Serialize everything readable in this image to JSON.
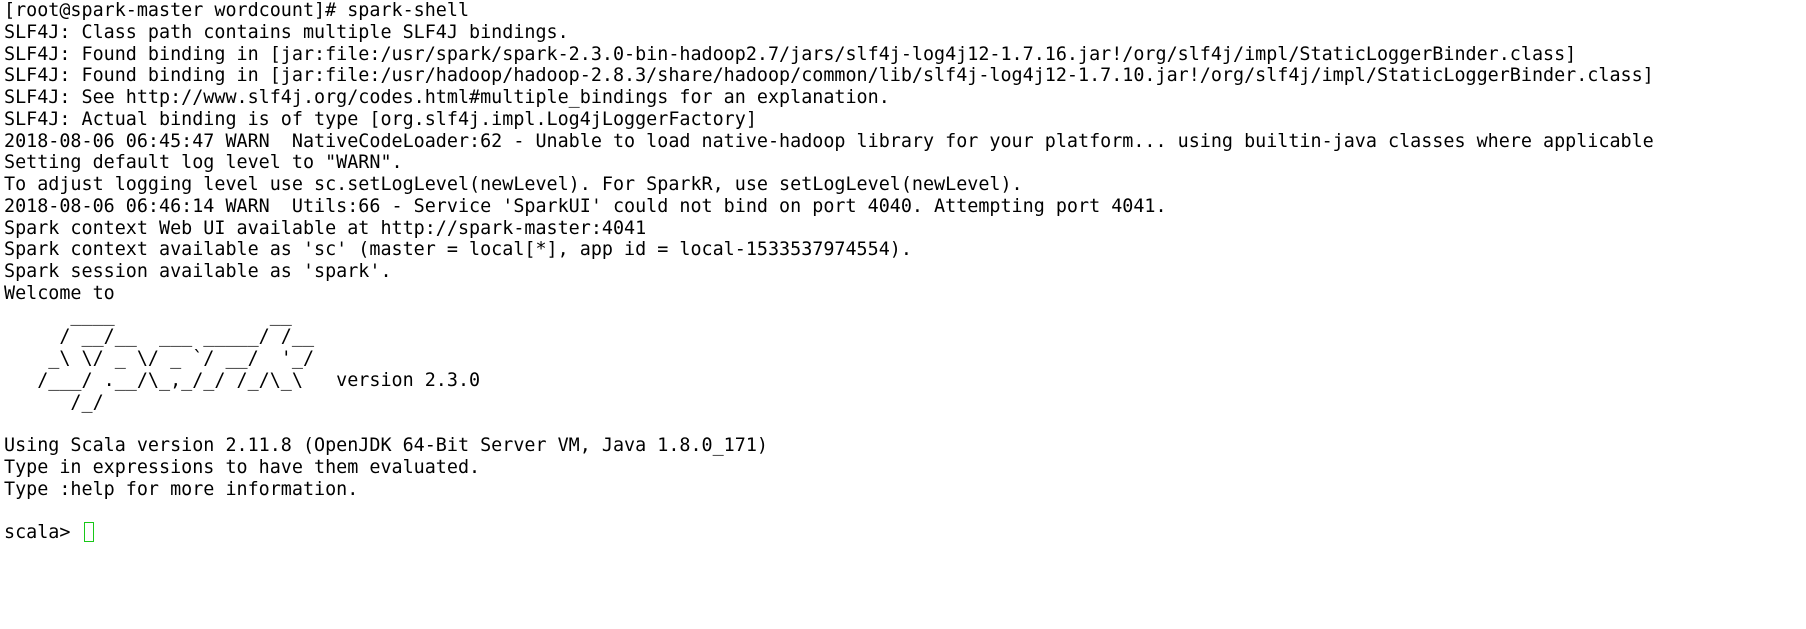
{
  "terminal": {
    "lines": [
      "[root@spark-master wordcount]# spark-shell",
      "SLF4J: Class path contains multiple SLF4J bindings.",
      "SLF4J: Found binding in [jar:file:/usr/spark/spark-2.3.0-bin-hadoop2.7/jars/slf4j-log4j12-1.7.16.jar!/org/slf4j/impl/StaticLoggerBinder.class]",
      "SLF4J: Found binding in [jar:file:/usr/hadoop/hadoop-2.8.3/share/hadoop/common/lib/slf4j-log4j12-1.7.10.jar!/org/slf4j/impl/StaticLoggerBinder.class]",
      "SLF4J: See http://www.slf4j.org/codes.html#multiple_bindings for an explanation.",
      "SLF4J: Actual binding is of type [org.slf4j.impl.Log4jLoggerFactory]",
      "2018-08-06 06:45:47 WARN  NativeCodeLoader:62 - Unable to load native-hadoop library for your platform... using builtin-java classes where applicable",
      "Setting default log level to \"WARN\".",
      "To adjust logging level use sc.setLogLevel(newLevel). For SparkR, use setLogLevel(newLevel).",
      "2018-08-06 06:46:14 WARN  Utils:66 - Service 'SparkUI' could not bind on port 4040. Attempting port 4041.",
      "Spark context Web UI available at http://spark-master:4041",
      "Spark context available as 'sc' (master = local[*], app id = local-1533537974554).",
      "Spark session available as 'spark'.",
      "Welcome to",
      "      ____              __",
      "     / __/__  ___ _____/ /__",
      "    _\\ \\/ _ \\/ _ `/ __/  '_/",
      "   /___/ .__/\\_,_/_/ /_/\\_\\   version 2.3.0",
      "      /_/",
      "",
      "Using Scala version 2.11.8 (OpenJDK 64-Bit Server VM, Java 1.8.0_171)",
      "Type in expressions to have them evaluated.",
      "Type :help for more information.",
      ""
    ],
    "prompt": "scala> "
  }
}
